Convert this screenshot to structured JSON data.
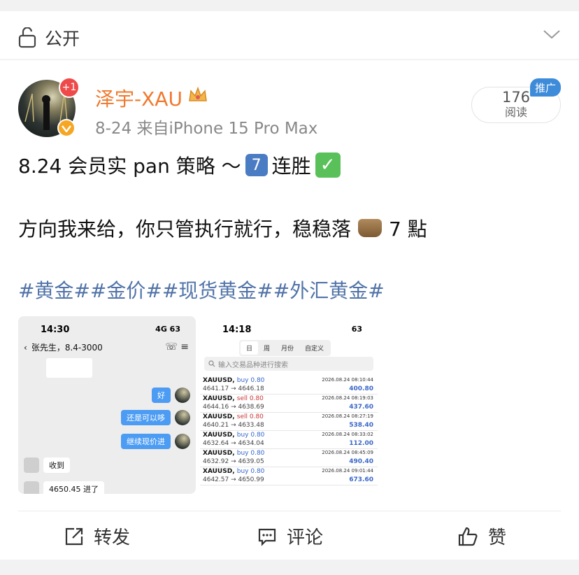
{
  "visibility": {
    "label": "公开",
    "lock_icon": "lock-open-icon",
    "chevron_icon": "chevron-down-icon"
  },
  "author": {
    "name": "泽宇-XAU",
    "plus_badge": "+1",
    "meta": "8-24  来自iPhone 15 Pro Max"
  },
  "reads": {
    "count": "176",
    "label": "阅读",
    "promo": "推广"
  },
  "post": {
    "line1_prefix": "8.24 会员实 pan 策略 ～",
    "line1_keycap": "7",
    "line1_suffix": "连胜",
    "line2_prefix": "方向我来给，你只管执行就行，稳稳落",
    "line2_suffix": "7 點",
    "hashtags": "#黄金##金价##现货黄金##外汇黄金#"
  },
  "chat_shot": {
    "time": "14:30",
    "status": "4G 63",
    "contact": "张先生，8.4-3000",
    "messages": [
      {
        "side": "right",
        "text": "好"
      },
      {
        "side": "right",
        "text": "还是可以哆"
      },
      {
        "side": "right",
        "text": "继续现价进"
      },
      {
        "side": "left",
        "text": "收到"
      },
      {
        "side": "left",
        "text": "4650.45 进了"
      }
    ]
  },
  "trade_shot": {
    "time": "14:18",
    "status": "63",
    "tabs": [
      "日",
      "周",
      "月份",
      "自定义"
    ],
    "active_tab": "日",
    "search_placeholder": "输入交易品种进行搜索",
    "trades": [
      {
        "symbol": "XAUUSD,",
        "side": "buy 0.80",
        "prices": "4641.17 → 4646.18",
        "time": "2026.08.24 08:10:44",
        "pnl": "400.80"
      },
      {
        "symbol": "XAUUSD,",
        "side": "sell 0.80",
        "prices": "4644.16 → 4638.69",
        "time": "2026.08.24 08:19:03",
        "pnl": "437.60"
      },
      {
        "symbol": "XAUUSD,",
        "side": "sell 0.80",
        "prices": "4640.21 → 4633.48",
        "time": "2026.08.24 08:27:19",
        "pnl": "538.40"
      },
      {
        "symbol": "XAUUSD,",
        "side": "buy 0.80",
        "prices": "4632.64 → 4634.04",
        "time": "2026.08.24 08:33:02",
        "pnl": "112.00"
      },
      {
        "symbol": "XAUUSD,",
        "side": "buy 0.80",
        "prices": "4632.92 → 4639.05",
        "time": "2026.08.24 08:45:09",
        "pnl": "490.40"
      },
      {
        "symbol": "XAUUSD,",
        "side": "buy 0.80",
        "prices": "4642.57 → 4650.99",
        "time": "2026.08.24 09:01:44",
        "pnl": "673.60"
      }
    ]
  },
  "actions": {
    "forward": "转发",
    "comment": "评论",
    "like": "赞"
  }
}
